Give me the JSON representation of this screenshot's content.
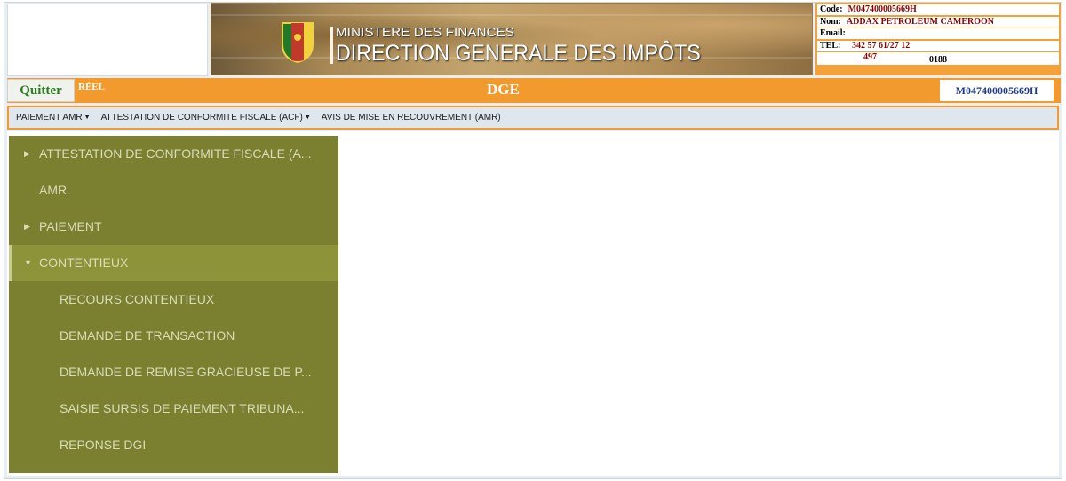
{
  "banner": {
    "line1": "MINISTERE DES FINANCES",
    "line2": "DIRECTION GENERALE DES IMPÔTS"
  },
  "info": {
    "code_label": "Code:",
    "code_value": "M047400005669H",
    "nom_label": "Nom:",
    "nom_value": "ADDAX PETROLEUM CAMEROON",
    "email_label": "Email:",
    "email_value": "",
    "tel_label": "TEL:",
    "tel_value": "342 57 61/27 12",
    "extra_1": "497",
    "extra_2": "0188"
  },
  "header": {
    "quit_label": "Quitter",
    "mode": "RÉEL",
    "title": "DGE",
    "code": "M047400005669H"
  },
  "menu": [
    {
      "label": "PAIEMENT AMR",
      "dropdown": true
    },
    {
      "label": "ATTESTATION DE CONFORMITE FISCALE (ACF)",
      "dropdown": true
    },
    {
      "label": "AVIS DE MISE EN RECOUVREMENT (AMR)",
      "dropdown": false
    }
  ],
  "sidebar": {
    "items": [
      {
        "label": "ATTESTATION DE CONFORMITE FISCALE (A...",
        "arrow": "right"
      },
      {
        "label": "AMR",
        "arrow": "none"
      },
      {
        "label": "PAIEMENT",
        "arrow": "right"
      },
      {
        "label": "CONTENTIEUX",
        "arrow": "down"
      },
      {
        "label": "RECOURS CONTENTIEUX"
      },
      {
        "label": "DEMANDE DE TRANSACTION"
      },
      {
        "label": "DEMANDE DE REMISE GRACIEUSE DE P..."
      },
      {
        "label": "SAISIE SURSIS DE PAIEMENT TRIBUNA..."
      },
      {
        "label": "REPONSE DGI"
      }
    ]
  },
  "colors": {
    "orange": "#f39a2e",
    "sidebar": "#7a8030",
    "code_text": "#8b0000"
  }
}
